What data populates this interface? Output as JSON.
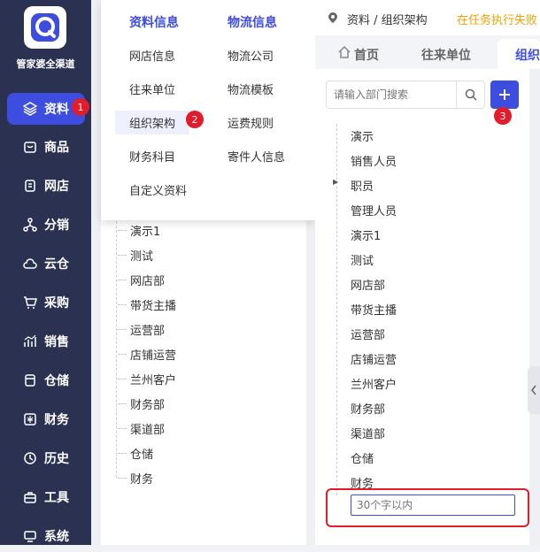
{
  "sidebar": {
    "logo_text": "管家婆全渠道",
    "items": [
      {
        "label": "资料",
        "icon": "layers-icon",
        "active": true,
        "badge": "1"
      },
      {
        "label": "商品",
        "icon": "box-icon"
      },
      {
        "label": "网店",
        "icon": "document-icon"
      },
      {
        "label": "分销",
        "icon": "network-icon"
      },
      {
        "label": "云仓",
        "icon": "cloud-icon"
      },
      {
        "label": "采购",
        "icon": "cart-icon"
      },
      {
        "label": "销售",
        "icon": "chart-icon"
      },
      {
        "label": "仓储",
        "icon": "storage-icon"
      },
      {
        "label": "财务",
        "icon": "finance-icon"
      },
      {
        "label": "历史",
        "icon": "history-icon"
      },
      {
        "label": "工具",
        "icon": "toolbox-icon"
      },
      {
        "label": "系统",
        "icon": "monitor-icon"
      }
    ]
  },
  "dropdown": {
    "col1_header": "资料信息",
    "col2_header": "物流信息",
    "col1_items": [
      "网店信息",
      "往来单位",
      "组织架构",
      "财务科目",
      "自定义资料"
    ],
    "col2_items": [
      "物流公司",
      "物流模板",
      "运费规则",
      "寄件人信息"
    ],
    "highlight_badge": "2"
  },
  "mid_tree": [
    "演示1",
    "测试",
    "网店部",
    "带货主播",
    "运营部",
    "店铺运营",
    "兰州客户",
    "财务部",
    "渠道部",
    "仓储",
    "财务"
  ],
  "header": {
    "breadcrumb": "资料 / 组织架构",
    "notice": "在任务执行失败"
  },
  "tabs": {
    "home": "首页",
    "partners": "往来单位",
    "org": "组织"
  },
  "right_panel": {
    "search_placeholder": "请输入部门搜索",
    "add_badge": "3",
    "tree": [
      "演示",
      "销售人员",
      "职员",
      "管理人员",
      "演示1",
      "测试",
      "网店部",
      "带货主播",
      "运营部",
      "店铺运营",
      "兰州客户",
      "财务部",
      "渠道部",
      "仓储",
      "财务"
    ],
    "new_node_placeholder": "30个字以内"
  },
  "colors": {
    "sidebar_bg": "#2b3150",
    "accent": "#3d4de0",
    "badge_red": "#e11d2b",
    "notice_orange": "#f0a000"
  }
}
